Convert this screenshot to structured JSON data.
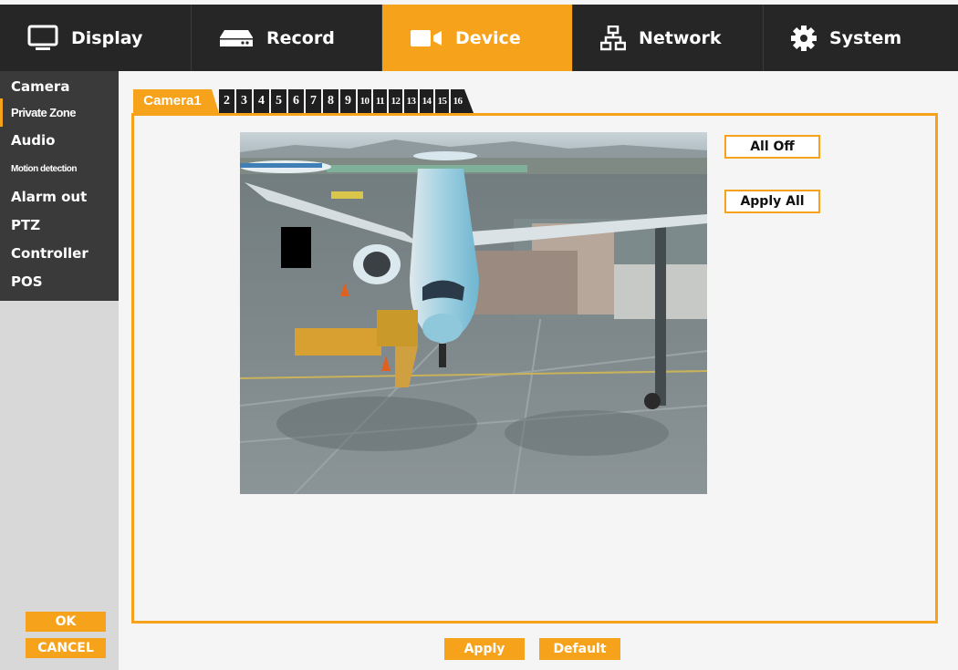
{
  "menu": {
    "tabs": [
      {
        "label": "Display",
        "icon": "monitor-icon"
      },
      {
        "label": "Record",
        "icon": "hard-drive-icon"
      },
      {
        "label": "Device",
        "icon": "camera-icon",
        "active": true
      },
      {
        "label": "Network",
        "icon": "network-icon"
      },
      {
        "label": "System",
        "icon": "gear-icon"
      }
    ],
    "accent": "#f7a21b",
    "background": "#262626"
  },
  "sidebar": {
    "items": [
      {
        "label": "Camera"
      },
      {
        "label": "Private Zone",
        "active": true
      },
      {
        "label": "Audio"
      },
      {
        "label": "Motion detection"
      },
      {
        "label": "Alarm out"
      },
      {
        "label": "PTZ"
      },
      {
        "label": "Controller"
      },
      {
        "label": "POS"
      }
    ],
    "ok_label": "OK",
    "cancel_label": "CANCEL"
  },
  "camera_tabs": {
    "active_label": "Camera1",
    "numbers": [
      "2",
      "3",
      "4",
      "5",
      "6",
      "7",
      "8",
      "9",
      "10",
      "11",
      "12",
      "13",
      "14",
      "15",
      "16"
    ]
  },
  "panel": {
    "all_off_label": "All Off",
    "apply_all_label": "Apply All"
  },
  "footer": {
    "apply_label": "Apply",
    "default_label": "Default"
  }
}
